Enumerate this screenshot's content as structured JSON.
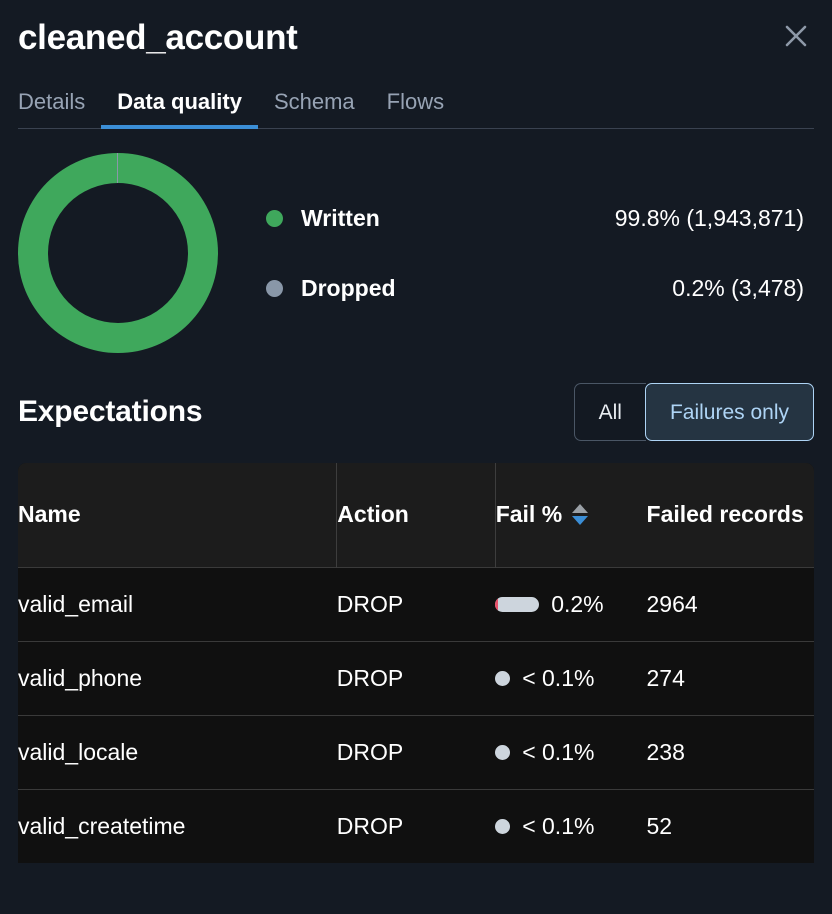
{
  "header": {
    "title": "cleaned_account",
    "close_label": "×",
    "close_icon": "close-icon"
  },
  "tabs": [
    {
      "label": "Details",
      "active": false
    },
    {
      "label": "Data quality",
      "active": true
    },
    {
      "label": "Schema",
      "active": false
    },
    {
      "label": "Flows",
      "active": false
    }
  ],
  "colors": {
    "written": "#3fa85c",
    "dropped": "#8997a8",
    "accent": "#3b8ed6",
    "selected_border": "#aed4f5",
    "fail_bar": "#cdd5dd",
    "fail_bar_accent": "#e8516a",
    "page_bg": "#141a23",
    "table_bg": "#101010",
    "table_header_bg": "#1c1c1c"
  },
  "chart_data": {
    "type": "pie",
    "title": "",
    "legend_position": "right",
    "categories": [
      "Written",
      "Dropped"
    ],
    "values": [
      99.8,
      0.2
    ],
    "counts": [
      1943871,
      3478
    ],
    "labels": [
      "99.8% (1,943,871)",
      "0.2% (3,478)"
    ],
    "colors": [
      "#3fa85c",
      "#8997a8"
    ],
    "donut": true
  },
  "legend": [
    {
      "label": "Written",
      "value": "99.8% (1,943,871)",
      "dot": "written-dot"
    },
    {
      "label": "Dropped",
      "value": "0.2% (3,478)",
      "dot": "dropped-dot"
    }
  ],
  "expectations": {
    "title": "Expectations",
    "filter": {
      "options": [
        {
          "label": "All",
          "selected": false
        },
        {
          "label": "Failures only",
          "selected": true
        }
      ]
    },
    "table": {
      "columns": [
        "Name",
        "Action",
        "Fail %",
        "Failed records"
      ],
      "sort": {
        "column": "Fail %",
        "direction": "desc"
      },
      "rows": [
        {
          "name": "valid_email",
          "action": "DROP",
          "fail_pct": "0.2%",
          "bar": "wide",
          "failed_records": "2964"
        },
        {
          "name": "valid_phone",
          "action": "DROP",
          "fail_pct": "< 0.1%",
          "bar": "tiny",
          "failed_records": "274"
        },
        {
          "name": "valid_locale",
          "action": "DROP",
          "fail_pct": "< 0.1%",
          "bar": "tiny",
          "failed_records": "238"
        },
        {
          "name": "valid_createtime",
          "action": "DROP",
          "fail_pct": "< 0.1%",
          "bar": "tiny",
          "failed_records": "52"
        }
      ]
    }
  }
}
